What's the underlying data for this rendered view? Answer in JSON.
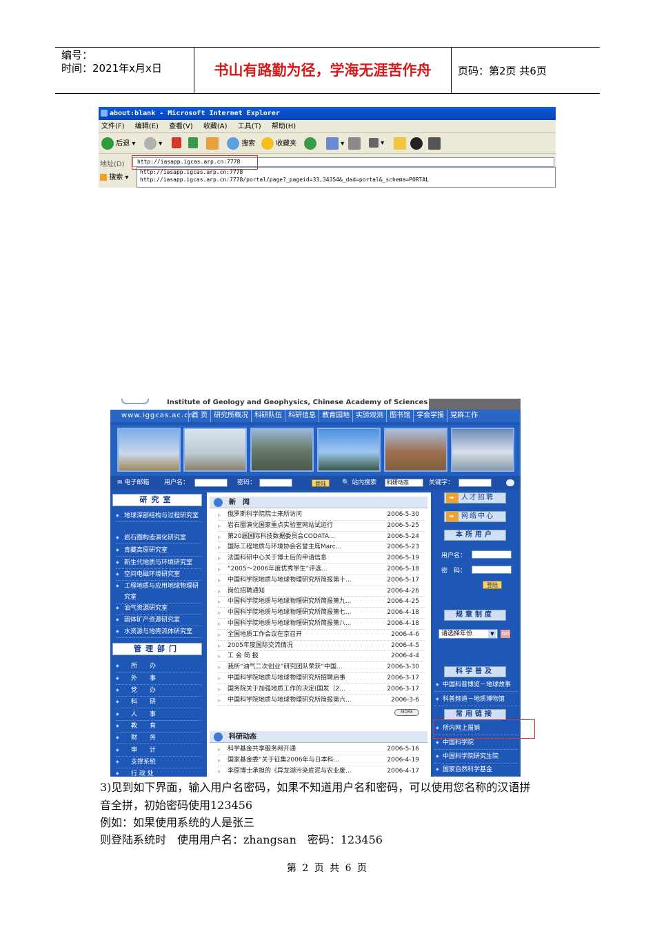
{
  "header": {
    "serial_label": "编号：",
    "time_label": "时间：2021年x月x日",
    "motto": "书山有路勤为径，学海无涯苦作舟",
    "page_label": "页码：第2页  共6页"
  },
  "ie": {
    "title": "about:blank - Microsoft Internet Explorer",
    "menu": [
      "文件(F)",
      "编辑(E)",
      "查看(V)",
      "收藏(A)",
      "工具(T)",
      "帮助(H)"
    ],
    "back_label": "后退",
    "search_label": "搜索",
    "favorites_label": "收藏夹",
    "address_label": "地址(D)",
    "search_bar_label": "搜索",
    "address_value": "http://iasapp.igcas.arp.cn:7778",
    "suggestions": [
      "http://iasapp.igcas.arp.cn:7778",
      "http://iasapp.igcas.arp.cn:7778/portal/page?_pageid=33,34354&_dad=portal&_schema=PORTAL"
    ]
  },
  "site": {
    "institute_name": "Institute of Geology and Geophysics, Chinese Academy of Sciences",
    "url": "www.iggcas.ac.cn",
    "nav": [
      "首 页",
      "研究所概况",
      "科研队伍",
      "科研信息",
      "教育园地",
      "实验观测",
      "图书馆",
      "学会学报",
      "党群工作"
    ],
    "login_bar": {
      "email": "电子邮箱",
      "username": "用户名：",
      "password": "密码：",
      "login": "登陆",
      "site_search": "站内搜索",
      "search_scope": "科研动态",
      "keyword": "关键字："
    },
    "labs_title": "研究室",
    "labs": [
      "地球深部结构与过程研究室",
      "岩石圈构造演化研究室",
      "青藏高原研究室",
      "新生代地质与环境研究室",
      "空间电磁环境研究室",
      "工程地质与应用地球物理研究室",
      "油气资源研究室",
      "固体矿产资源研究室",
      "水资源与地壳流体研究室"
    ],
    "depts_title": "管理部门",
    "depts": [
      "所　　办",
      "外　　事",
      "党　　办",
      "科　　研",
      "人　　事",
      "教　　育",
      "财　　务",
      "审　　计",
      "支撑系统",
      "行 政 处"
    ],
    "news_title": "新　闻",
    "news": [
      {
        "title": "俄罗斯科学院院士来所访问",
        "date": "2006-5-30"
      },
      {
        "title": "岩石圈演化国家重点实验室网站试运行",
        "date": "2006-5-25"
      },
      {
        "title": "第20届国际科技数据委员会CODATA...",
        "date": "2006-5-24"
      },
      {
        "title": "国际工程地质与环境协会名誉主席Marc...",
        "date": "2006-5-23"
      },
      {
        "title": "法国科研中心关于博士后的申请信息",
        "date": "2006-5-19"
      },
      {
        "title": "“2005～2006年度优秀学生”评选...",
        "date": "2006-5-18"
      },
      {
        "title": "中国科学院地质与地球物理研究所简报第十...",
        "date": "2006-5-17"
      },
      {
        "title": "岗位招聘通知",
        "date": "2006-4-26"
      },
      {
        "title": "中国科学院地质与地球物理研究所简报第九...",
        "date": "2006-4-25"
      },
      {
        "title": "中国科学院地质与地球物理研究所简报第七...",
        "date": "2006-4-18"
      },
      {
        "title": "中国科学院地质与地球物理研究所简报第八...",
        "date": "2006-4-18"
      },
      {
        "title": "全国地质工作会议在京召开",
        "date": "2006-4-6"
      },
      {
        "title": "2005年度国际交流情况",
        "date": "2006-4-5"
      },
      {
        "title": "工 会 简 报",
        "date": "2006-4-4"
      },
      {
        "title": "我所“油气二次创业”研究团队荣获“中国...",
        "date": "2006-3-30"
      },
      {
        "title": "中国科学院地质与地球物理研究所招聘启事",
        "date": "2006-3-17"
      },
      {
        "title": "国务院关于加强地质工作的决定(国发〔2...",
        "date": "2006-3-17"
      },
      {
        "title": "中国科学院地质与地球物理研究所简报第六...",
        "date": "2006-3-6"
      }
    ],
    "more_label": "MORE",
    "research_title": "科研动态",
    "research": [
      {
        "title": "科学基金共享服务网开通",
        "date": "2006-5-16"
      },
      {
        "title": "国家基金委“关于征集2006年与日本科...",
        "date": "2006-4-19"
      },
      {
        "title": "李原博士承担的《异龙湖污染底泥与农业废...",
        "date": "2006-4-17"
      }
    ],
    "right": {
      "talent": "人才招聘",
      "network": "网络中心",
      "users_title": "本所用户",
      "username": "用户名：",
      "password": "密　码：",
      "login": "登陆",
      "rules_title": "规章制度",
      "year_select": "请选择年份",
      "go": "GO",
      "science_title": "科学普及",
      "science_items": [
        "中国科普博览－地球故事",
        "科普频道－地质博物馆"
      ],
      "links_title": "常用链接",
      "links": [
        "所内网上报销",
        "中国科学院",
        "中国科学院研究生院",
        "国家自然科学基金"
      ]
    }
  },
  "body_text": [
    "3)见到如下界面，输入用户名密码，如果不知道用户名和密码，可以使用您名称的汉语拼",
    "音全拼，初始密码使用123456",
    "例如：如果使用系统的人是张三",
    "则登陆系统时　使用用户名：zhangsan　密码：123456"
  ],
  "footer": "第 2 页 共 6 页"
}
